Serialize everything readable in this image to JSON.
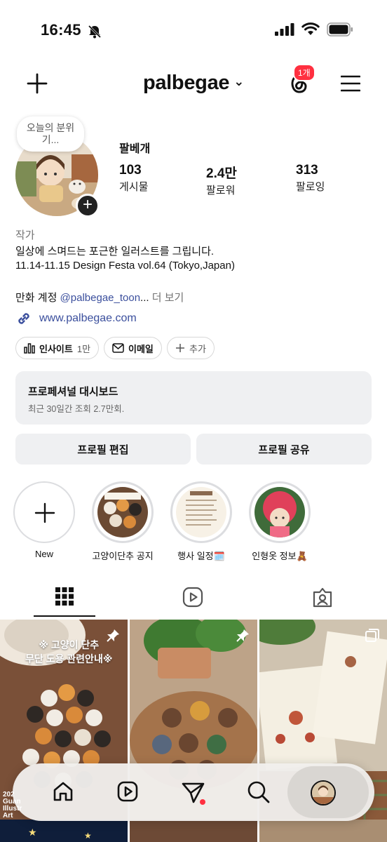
{
  "status_bar": {
    "time": "16:45"
  },
  "header": {
    "username": "palbegae",
    "threads_badge": "1개"
  },
  "profile": {
    "note": "오늘의 분위기...",
    "display_name": "팔베개",
    "stats": [
      {
        "value": "103",
        "label": "게시물"
      },
      {
        "value": "2.4만",
        "label": "팔로워"
      },
      {
        "value": "313",
        "label": "팔로잉"
      }
    ],
    "category": "작가",
    "bio_line1": "일상에 스며드는 포근한 일러스트를 그립니다.",
    "bio_line2": "11.14-11.15 Design Festa vol.64 (Tokyo,Japan)",
    "bio_line3_prefix": "만화 계정 ",
    "bio_line3_mention": "@palbegae_toon",
    "bio_line3_ellipsis": "...",
    "bio_more": " 더 보기",
    "link": "www.palbegae.com"
  },
  "chips": {
    "insights_label": "인사이트",
    "insights_count": "1만",
    "email_label": "이메일",
    "add_label": "추가"
  },
  "dashboard": {
    "title": "프로페셔널 대시보드",
    "subtitle": "최근 30일간 조회 2.7만회."
  },
  "buttons": {
    "edit_profile": "프로필 편집",
    "share_profile": "프로필 공유"
  },
  "highlights": [
    {
      "label": "New"
    },
    {
      "label": "고양이단추 공지"
    },
    {
      "label": "행사 일정🗓️"
    },
    {
      "label": "인형옷 정보🧸"
    }
  ],
  "posts": {
    "post1_caption_line1": "※ 고양이 단추",
    "post1_caption_line2": "무단 도용 관련안내※",
    "bottom_left_text_1": "202",
    "bottom_left_text_2": "Guan",
    "bottom_left_text_3": "Illustr",
    "bottom_left_text_4": "Art"
  },
  "icons": {
    "create": "plus-icon",
    "threads": "threads-icon",
    "menu": "hamburger-icon",
    "insights": "bar-chart-icon",
    "email": "mail-icon",
    "link": "link-icon",
    "grid": "grid-icon",
    "reels": "reels-icon",
    "tagged": "tagged-icon",
    "home": "home-icon",
    "send": "send-icon",
    "search": "search-icon",
    "pin": "pin-icon"
  },
  "colors": {
    "link_blue": "#3b4f9d",
    "badge_red": "#ff3040",
    "button_gray": "#eff0f2"
  }
}
